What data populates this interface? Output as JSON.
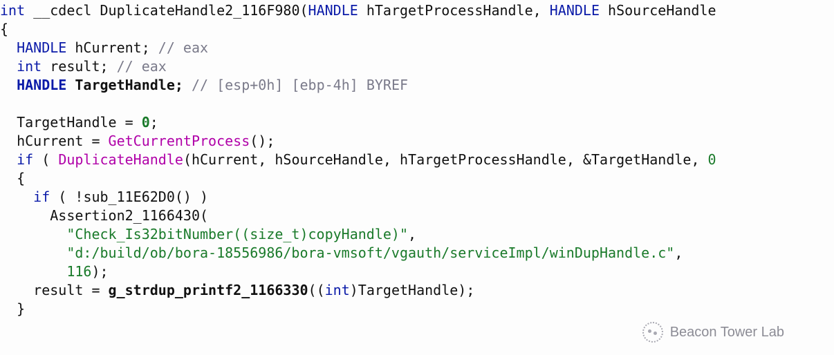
{
  "code": {
    "lines": [
      {
        "indent": 0,
        "tokens": [
          {
            "cls": "c-keyword",
            "t": "int"
          },
          {
            "cls": "c-text",
            "t": " __cdecl "
          },
          {
            "cls": "c-funcdef",
            "t": "DuplicateHandle2_116F980"
          },
          {
            "cls": "c-text",
            "t": "("
          },
          {
            "cls": "c-type",
            "t": "HANDLE"
          },
          {
            "cls": "c-text",
            "t": " hTargetProcessHandle, "
          },
          {
            "cls": "c-type",
            "t": "HANDLE"
          },
          {
            "cls": "c-text",
            "t": " hSourceHandle"
          }
        ]
      },
      {
        "indent": 0,
        "tokens": [
          {
            "cls": "c-text",
            "t": "{"
          }
        ]
      },
      {
        "indent": 1,
        "tokens": [
          {
            "cls": "c-type",
            "t": "HANDLE"
          },
          {
            "cls": "c-text",
            "t": " hCurrent; "
          },
          {
            "cls": "c-comment",
            "t": "// eax"
          }
        ]
      },
      {
        "indent": 1,
        "tokens": [
          {
            "cls": "c-keyword",
            "t": "int"
          },
          {
            "cls": "c-text",
            "t": " result; "
          },
          {
            "cls": "c-comment",
            "t": "// eax"
          }
        ]
      },
      {
        "indent": 1,
        "tokens": [
          {
            "cls": "c-type c-bold",
            "t": "HANDLE"
          },
          {
            "cls": "c-text c-bold",
            "t": " TargetHandle; "
          },
          {
            "cls": "c-comment",
            "t": "// [esp+0h] [ebp-4h] BYREF"
          }
        ]
      },
      {
        "indent": 0,
        "tokens": [
          {
            "cls": "c-text",
            "t": ""
          }
        ]
      },
      {
        "indent": 1,
        "tokens": [
          {
            "cls": "c-text",
            "t": "TargetHandle = "
          },
          {
            "cls": "c-num c-bold",
            "t": "0"
          },
          {
            "cls": "c-text",
            "t": ";"
          }
        ]
      },
      {
        "indent": 1,
        "tokens": [
          {
            "cls": "c-text",
            "t": "hCurrent = "
          },
          {
            "cls": "c-call",
            "t": "GetCurrentProcess"
          },
          {
            "cls": "c-text",
            "t": "();"
          }
        ]
      },
      {
        "indent": 1,
        "tokens": [
          {
            "cls": "c-keyword",
            "t": "if"
          },
          {
            "cls": "c-text",
            "t": " ( "
          },
          {
            "cls": "c-call",
            "t": "DuplicateHandle"
          },
          {
            "cls": "c-text",
            "t": "(hCurrent, hSourceHandle, hTargetProcessHandle, "
          },
          {
            "cls": "c-amp",
            "t": "&"
          },
          {
            "cls": "c-text",
            "t": "TargetHandle, "
          },
          {
            "cls": "c-num",
            "t": "0"
          }
        ]
      },
      {
        "indent": 1,
        "tokens": [
          {
            "cls": "c-text",
            "t": "{"
          }
        ]
      },
      {
        "indent": 2,
        "tokens": [
          {
            "cls": "c-keyword",
            "t": "if"
          },
          {
            "cls": "c-text",
            "t": " ( !"
          },
          {
            "cls": "c-callblk",
            "t": "sub_11E62D0"
          },
          {
            "cls": "c-text",
            "t": "() )"
          }
        ]
      },
      {
        "indent": 3,
        "tokens": [
          {
            "cls": "c-callblk",
            "t": "Assertion2_1166430"
          },
          {
            "cls": "c-text",
            "t": "("
          }
        ]
      },
      {
        "indent": 4,
        "tokens": [
          {
            "cls": "c-str",
            "t": "\"Check_Is32bitNumber((size_t)copyHandle)\""
          },
          {
            "cls": "c-text",
            "t": ","
          }
        ]
      },
      {
        "indent": 4,
        "tokens": [
          {
            "cls": "c-str",
            "t": "\"d:/build/ob/bora-18556986/bora-vmsoft/vgauth/serviceImpl/winDupHandle.c\""
          },
          {
            "cls": "c-text",
            "t": ","
          }
        ]
      },
      {
        "indent": 4,
        "tokens": [
          {
            "cls": "c-num",
            "t": "116"
          },
          {
            "cls": "c-text",
            "t": ");"
          }
        ]
      },
      {
        "indent": 2,
        "tokens": [
          {
            "cls": "c-text",
            "t": "result = "
          },
          {
            "cls": "c-callblk c-bold",
            "t": "g_strdup_printf2_1166330"
          },
          {
            "cls": "c-text",
            "t": "(("
          },
          {
            "cls": "c-keyword",
            "t": "int"
          },
          {
            "cls": "c-text",
            "t": ")TargetHandle);"
          }
        ]
      },
      {
        "indent": 1,
        "tokens": [
          {
            "cls": "c-text",
            "t": "}"
          }
        ]
      }
    ],
    "indent_unit": "  "
  },
  "watermark": {
    "text": "Beacon Tower Lab"
  }
}
